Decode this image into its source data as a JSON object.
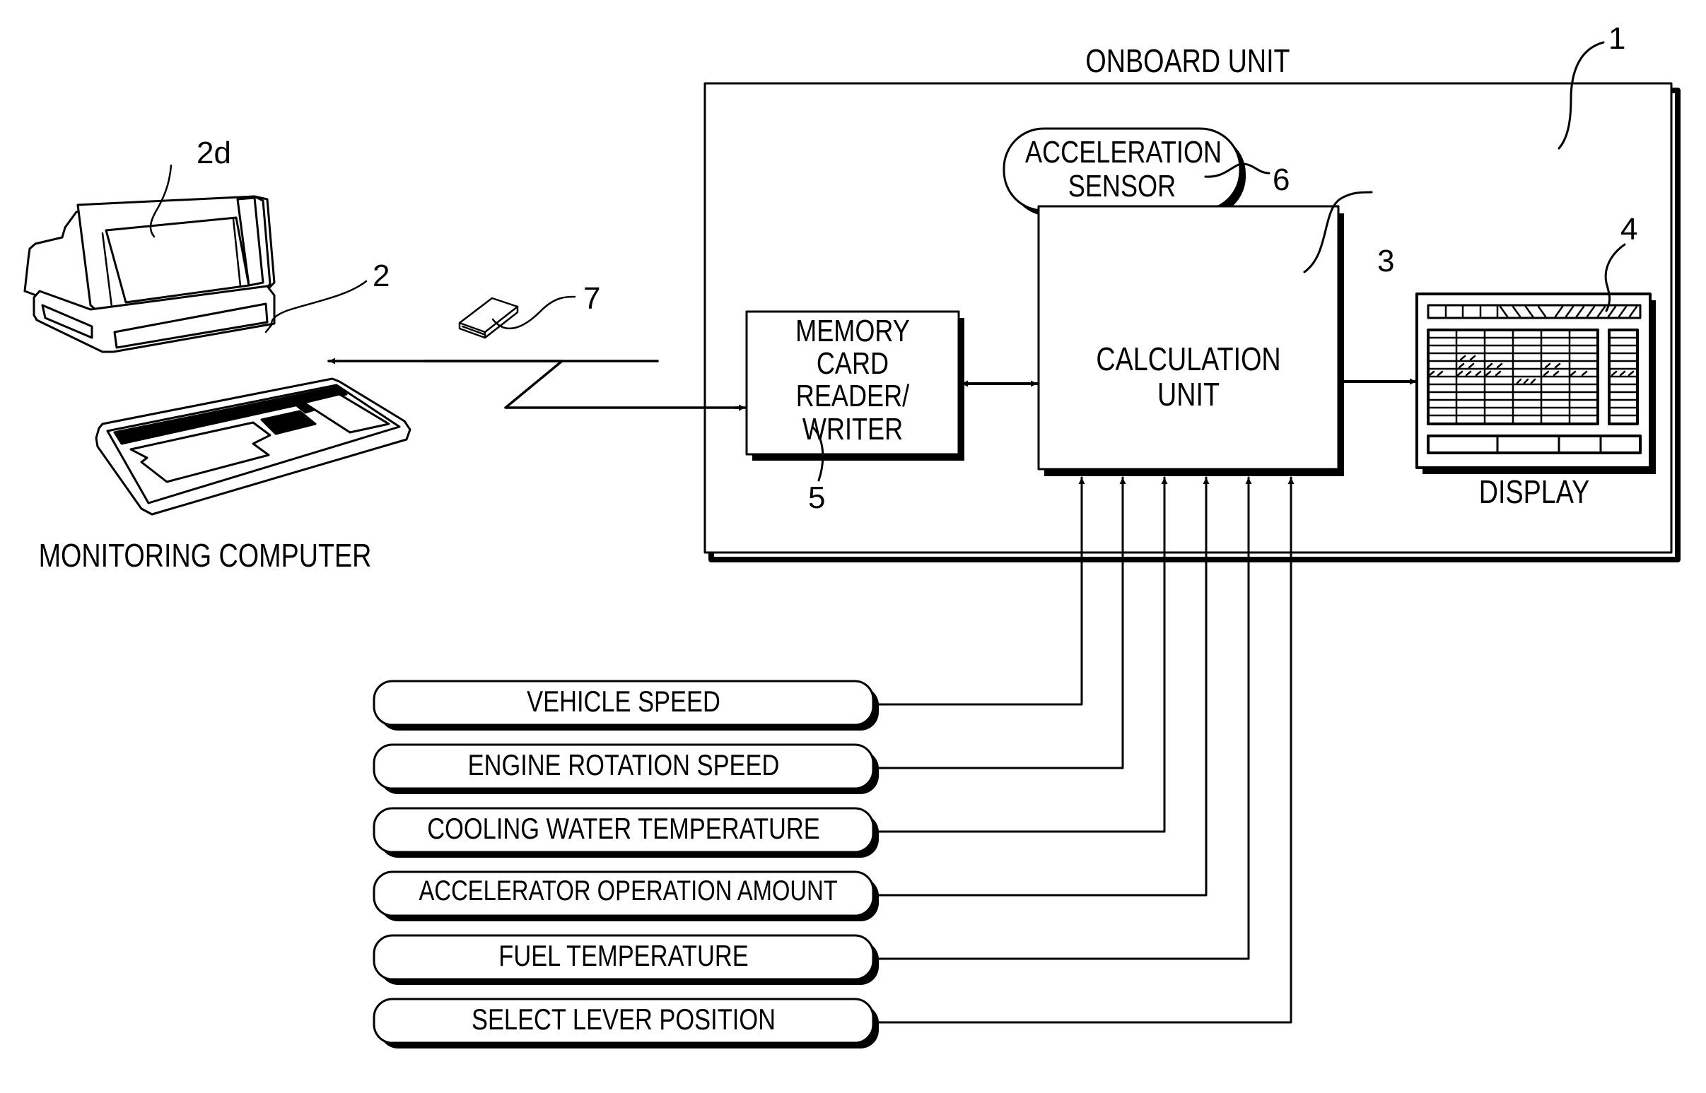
{
  "figure": {
    "onboard_unit": {
      "title": "ONBOARD UNIT",
      "ref": "1"
    },
    "monitoring_computer": {
      "title": "MONITORING COMPUTER",
      "ref": "2",
      "screen_ref": "2d"
    },
    "memory_card": {
      "ref": "7"
    },
    "memory_card_reader_writer": {
      "lines": [
        "MEMORY",
        "CARD",
        "READER/",
        "WRITER"
      ],
      "ref": "5"
    },
    "calculation_unit": {
      "lines": [
        "CALCULATION",
        "UNIT"
      ],
      "ref": "3"
    },
    "acceleration_sensor": {
      "lines": [
        "ACCELERATION",
        "SENSOR"
      ],
      "ref": "6"
    },
    "display": {
      "title": "DISPLAY",
      "ref": "4"
    },
    "inputs": [
      {
        "label": "VEHICLE SPEED"
      },
      {
        "label": "ENGINE ROTATION SPEED"
      },
      {
        "label": "COOLING WATER TEMPERATURE"
      },
      {
        "label": "ACCELERATOR OPERATION AMOUNT"
      },
      {
        "label": "FUEL TEMPERATURE"
      },
      {
        "label": "SELECT LEVER POSITION"
      }
    ],
    "colors": {
      "ink": "#000000",
      "paper": "#ffffff"
    }
  }
}
